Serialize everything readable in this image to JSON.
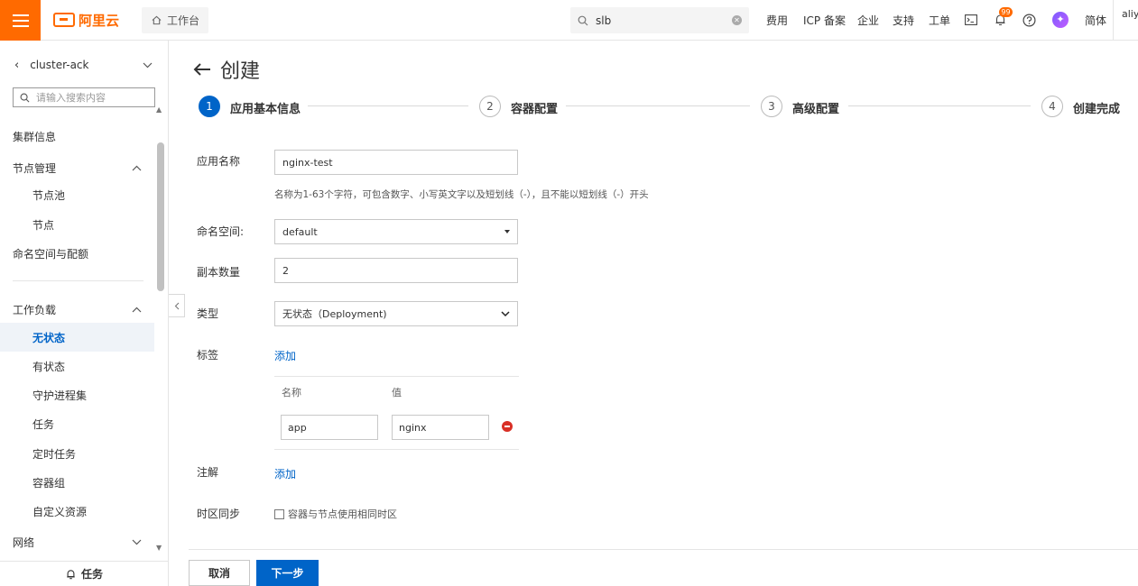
{
  "colors": {
    "brand": "#ff6a00",
    "primary": "#0064c8",
    "danger": "#d93026"
  },
  "topbar": {
    "logo_text": "阿里云",
    "workbench": "工作台",
    "search_value": "slb",
    "nav": [
      "费用",
      "ICP 备案",
      "企业",
      "支持",
      "工单"
    ],
    "notification_count": "99",
    "language": "简体",
    "user": "aliyu"
  },
  "sidebar": {
    "cluster": "cluster-ack",
    "search_placeholder": "请输入搜索内容",
    "items": [
      {
        "label": "集群信息"
      },
      {
        "label": "节点管理"
      },
      {
        "label": "节点池"
      },
      {
        "label": "节点"
      },
      {
        "label": "命名空间与配额"
      },
      {
        "label": "工作负载"
      },
      {
        "label": "无状态"
      },
      {
        "label": "有状态"
      },
      {
        "label": "守护进程集"
      },
      {
        "label": "任务"
      },
      {
        "label": "定时任务"
      },
      {
        "label": "容器组"
      },
      {
        "label": "自定义资源"
      },
      {
        "label": "网络"
      }
    ],
    "task_label": "任务"
  },
  "page": {
    "title": "创建",
    "steps": [
      {
        "num": "1",
        "label": "应用基本信息"
      },
      {
        "num": "2",
        "label": "容器配置"
      },
      {
        "num": "3",
        "label": "高级配置"
      },
      {
        "num": "4",
        "label": "创建完成"
      }
    ]
  },
  "form": {
    "app_name_label": "应用名称",
    "app_name_value": "nginx-test",
    "app_name_hint": "名称为1-63个字符，可包含数字、小写英文字以及短划线（-），且不能以短划线（-）开头",
    "namespace_label": "命名空间:",
    "namespace_value": "default",
    "replicas_label": "副本数量",
    "replicas_value": "2",
    "type_label": "类型",
    "type_value": "无状态（Deployment)",
    "labels_label": "标签",
    "add_label": "添加",
    "labels_table": {
      "col_name": "名称",
      "col_value": "值",
      "rows": [
        {
          "name": "app",
          "value": "nginx"
        }
      ]
    },
    "annotations_label": "注解",
    "add_annotation": "添加",
    "timezone_label": "时区同步",
    "timezone_checkbox": "容器与节点使用相同时区"
  },
  "footer": {
    "cancel": "取消",
    "next": "下一步"
  }
}
